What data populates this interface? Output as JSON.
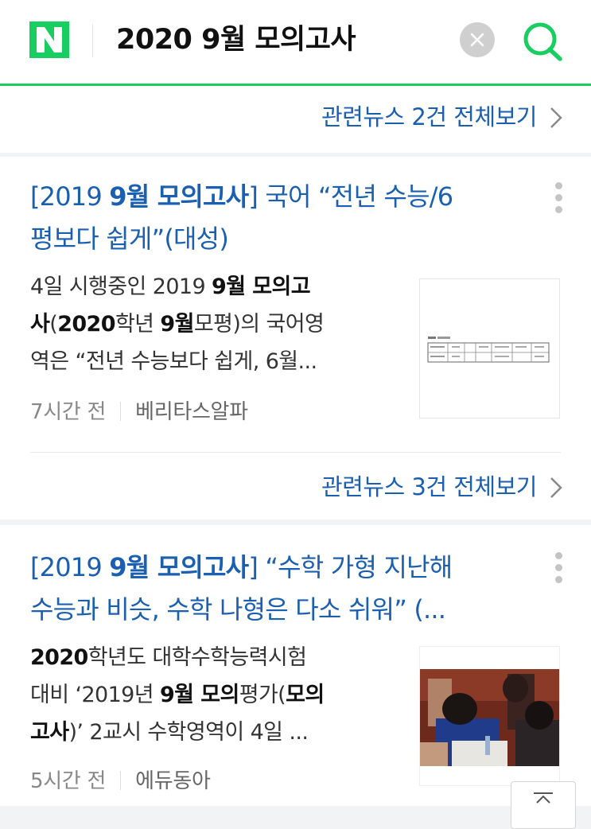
{
  "header": {
    "logo": "N",
    "query": "2020 9월 모의고사",
    "clear_icon": "close-icon",
    "search_icon": "search-icon"
  },
  "related_1": {
    "label": "관련뉴스 2건 전체보기",
    "icon": "chevron-right-icon"
  },
  "articles": [
    {
      "title_parts": [
        "[2019 ",
        "9월 모의고사",
        "] 국어 “전년 수능/6"
      ],
      "title_line2": "평보다 쉽게”(대성)",
      "snippet_line1": [
        "4일 시행중인 2019 ",
        "9월 모의고"
      ],
      "snippet_line2": [
        "사",
        "(",
        "2020",
        "학년 ",
        "9월",
        "모평)의 국어영"
      ],
      "snippet_line3": "역은 “전년 수능보다 쉽게, 6월...",
      "time": "7시간 전",
      "source": "베리타스알파",
      "thumbnail": "table-document-thumbnail"
    },
    {
      "title_parts": [
        "[2019 ",
        "9월 모의고사",
        "] “수학 가형 지난해"
      ],
      "title_line2": "수능과 비슷, 수학 나형은 다소 쉬워” (...",
      "snippet_line1": [
        "2020",
        "학년도 대학수학능력시험"
      ],
      "snippet_line2": [
        "대비 ‘2019년 ",
        "9월 모의",
        "평가(",
        "모의"
      ],
      "snippet_line3": [
        "고사",
        ")’ 2교시 수학영역이 4일 ..."
      ],
      "time": "5시간 전",
      "source": "에듀동아",
      "thumbnail": "exam-classroom-photo"
    }
  ],
  "related_2": {
    "label": "관련뉴스 3건 전체보기",
    "icon": "chevron-right-icon"
  },
  "colors": {
    "brand_green": "#19ce60",
    "link_blue": "#1a5fb0"
  },
  "scroll_top_icon": "arrow-up-icon"
}
